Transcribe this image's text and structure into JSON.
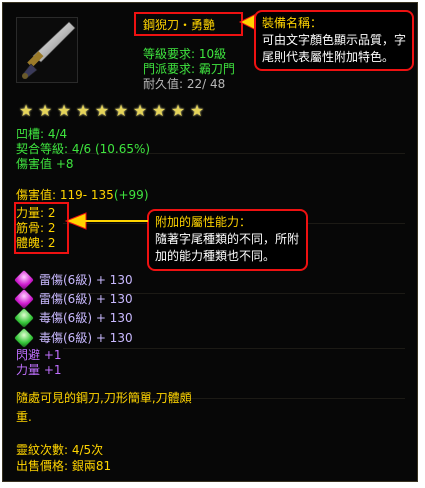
{
  "item": {
    "name": "鋼猊刀・勇艷",
    "level_req": "等級要求: 10級",
    "faction_req": "門派要求: 霸刀門",
    "durability": "耐久值: 22/ 48",
    "star_count": 10,
    "slots": "凹槽: 4/4",
    "fit_level": "契合等級: 4/6 (10.65%)",
    "damage_bonus": "傷害值 +8",
    "damage": "傷害值: 119- 135",
    "damage_extra": "(+99)",
    "stats": [
      "力量: 2",
      "筋骨: 2",
      "體魄: 2"
    ],
    "effects": [
      {
        "gem": "pink",
        "label": "雷傷(6級) + 130"
      },
      {
        "gem": "pink",
        "label": "雷傷(6級) + 130"
      },
      {
        "gem": "green",
        "label": "毒傷(6級) + 130"
      },
      {
        "gem": "green",
        "label": "毒傷(6級) + 130"
      }
    ],
    "bonus_lines": [
      "閃避 +1",
      "力量 +1"
    ],
    "description_1": "隨處可見的鋼刀,刀形簡單,刀體頗",
    "description_2": "重.",
    "refine_count": "靈紋次數: 4/5次",
    "sell_price": "出售價格: 銀兩81"
  },
  "callouts": {
    "name_title": "裝備名稱：",
    "name_body_1": "可由文字顏色顯示品質，字",
    "name_body_2": "尾則代表屬性附加特色。",
    "attr_title": "附加的屬性能力：",
    "attr_body_1": "隨著字尾種類的不同，所附",
    "attr_body_2": "加的能力種類也不同。"
  },
  "colors": {
    "highlight_border": "#ee1111",
    "name_gold": "#ffd400",
    "stat_green": "#3fe53f"
  }
}
